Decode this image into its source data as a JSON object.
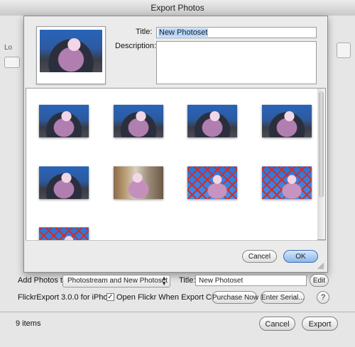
{
  "window": {
    "title": "Export Photos"
  },
  "sheet": {
    "title_label": "Title:",
    "title_value": "New Photoset",
    "description_label": "Description:",
    "photo_count": 9,
    "cancel_label": "Cancel",
    "ok_label": "OK"
  },
  "bottom": {
    "add_photos_label": "Add Photos to:",
    "add_photos_value": "Photostream and New Photoset",
    "title_label": "Title:",
    "title_value": "New Photoset",
    "edit_label": "Edit",
    "version_text": "FlickrExport 3.0.0 for iPhoto",
    "open_flickr_label": "Open Flickr When Export Complete",
    "open_flickr_checked": true,
    "purchase_label": "Purchase Now",
    "enter_serial_label": "Enter Serial...",
    "help_label": "?",
    "items_count": "9 items",
    "cancel_label": "Cancel",
    "export_label": "Export"
  },
  "background_fragments": {
    "lo": "Lo"
  }
}
